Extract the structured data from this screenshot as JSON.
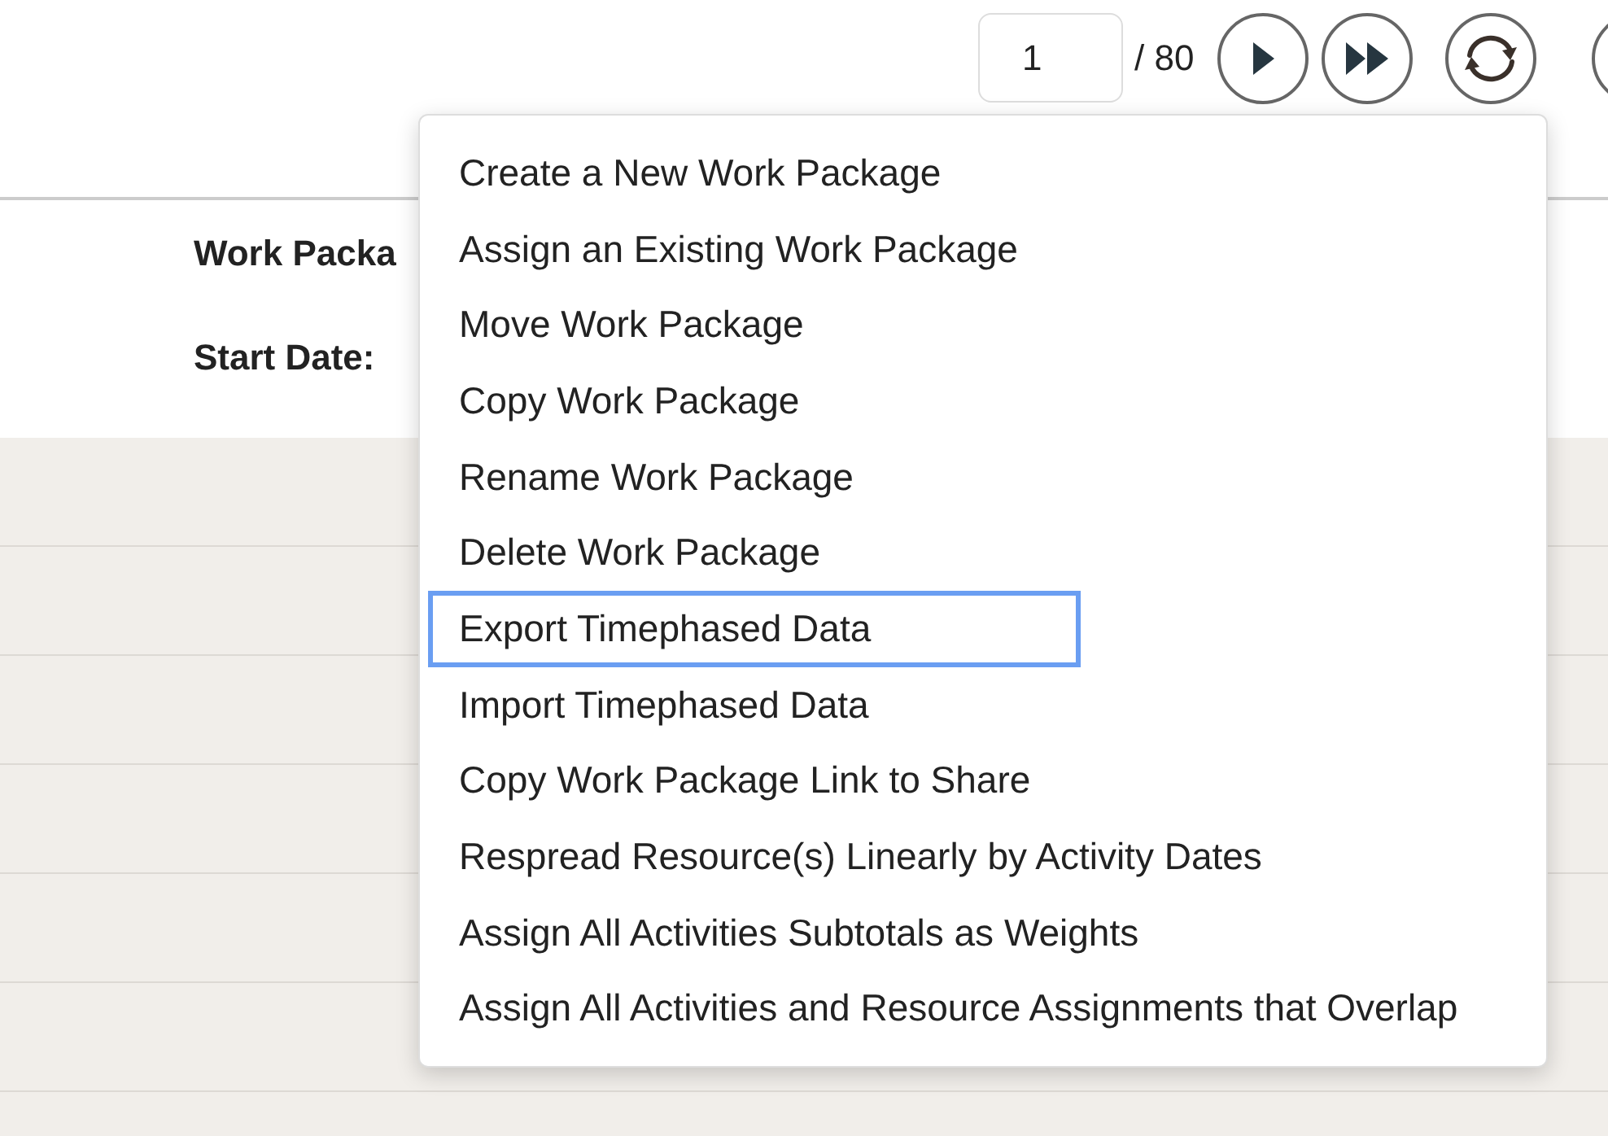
{
  "pager": {
    "page": "1",
    "total": "/ 80"
  },
  "header": {
    "labels": [
      "Work Packa",
      "Start Date:"
    ]
  },
  "menu": {
    "items": [
      {
        "label": "Create a New Work Package",
        "focused": false
      },
      {
        "label": "Assign an Existing Work Package",
        "focused": false
      },
      {
        "label": "Move Work Package",
        "focused": false
      },
      {
        "label": "Copy Work Package",
        "focused": false
      },
      {
        "label": "Rename Work Package",
        "focused": false
      },
      {
        "label": "Delete Work Package",
        "focused": false
      },
      {
        "label": "Export Timephased Data",
        "focused": true
      },
      {
        "label": "Import Timephased Data",
        "focused": false
      },
      {
        "label": "Copy Work Package Link to Share",
        "focused": false
      },
      {
        "label": "Respread Resource(s) Linearly by Activity Dates",
        "focused": false
      },
      {
        "label": "Assign All Activities Subtotals as Weights",
        "focused": false
      },
      {
        "label": "Assign All Activities and Resource Assignments that Overlap",
        "focused": false
      }
    ]
  }
}
